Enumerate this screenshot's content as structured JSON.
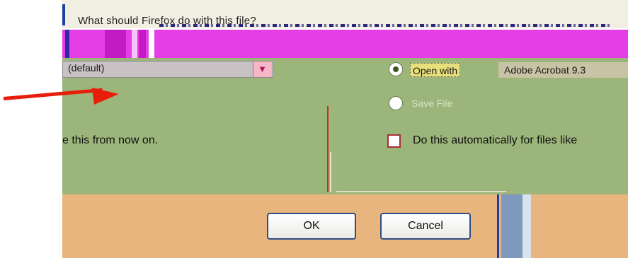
{
  "dialog": {
    "question": "What should Firefox do with this file?",
    "application_dropdown": "(default)",
    "open_with_label": "Open with",
    "open_with_app": "Adobe Acrobat 9.3",
    "save_file_label": "Save File",
    "remember_text": "e this from now on.",
    "auto_checkbox_label": "Do this automatically for files like",
    "ok_label": "OK",
    "cancel_label": "Cancel"
  },
  "state": {
    "open_with_selected": true,
    "save_file_selected": false,
    "auto_checked": false
  },
  "colors": {
    "panel_green": "#9bb57a",
    "glitch_magenta": "#e53ee6",
    "button_bar": "#e9b57e",
    "arrow_red": "#e81e0a"
  },
  "icons": {
    "dropdown_caret": "chevron-down-icon",
    "annotation": "red-arrow-icon"
  }
}
